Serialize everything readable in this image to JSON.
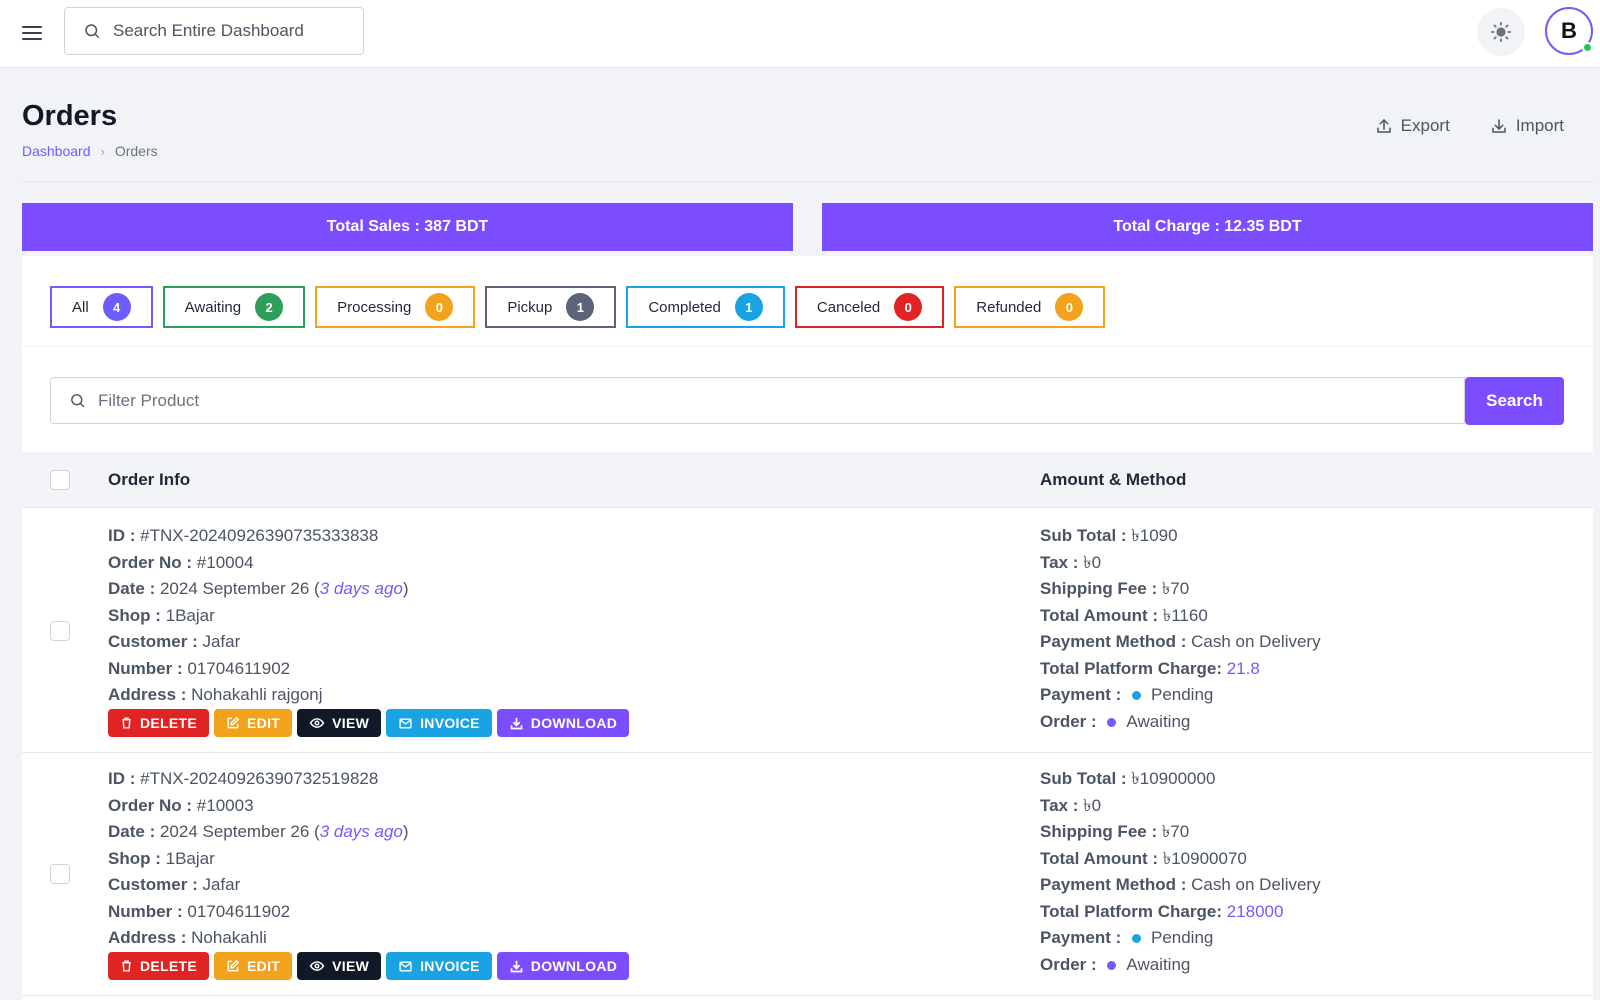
{
  "topbar": {
    "search_placeholder": "Search Entire Dashboard",
    "avatar_letter": "B"
  },
  "page": {
    "title": "Orders",
    "breadcrumb": [
      "Dashboard",
      "Orders"
    ],
    "export_label": "Export",
    "import_label": "Import"
  },
  "totals": {
    "sales": "Total Sales : 387 BDT",
    "charge": "Total Charge : 12.35 BDT"
  },
  "tabs": [
    {
      "label": "All",
      "count": "4",
      "color": "#6d5dfc"
    },
    {
      "label": "Awaiting",
      "count": "2",
      "color": "#2e9e5b"
    },
    {
      "label": "Processing",
      "count": "0",
      "color": "#f2a31b"
    },
    {
      "label": "Pickup",
      "count": "1",
      "color": "#5b6478"
    },
    {
      "label": "Completed",
      "count": "1",
      "color": "#1aa3e3"
    },
    {
      "label": "Canceled",
      "count": "0",
      "color": "#e02424"
    },
    {
      "label": "Refunded",
      "count": "0",
      "color": "#f2a31b"
    }
  ],
  "filter": {
    "placeholder": "Filter Product",
    "search_label": "Search"
  },
  "table": {
    "col_order_info": "Order Info",
    "col_amount_method": "Amount & Method"
  },
  "labels": {
    "id": "ID :",
    "order_no": "Order No :",
    "date": "Date :",
    "shop": "Shop :",
    "customer": "Customer :",
    "number": "Number :",
    "address": "Address :",
    "sub_total": "Sub Total :",
    "tax": "Tax :",
    "shipping_fee": "Shipping Fee :",
    "total_amount": "Total Amount :",
    "payment_method": "Payment Method :",
    "total_platform_charge": "Total Platform Charge:",
    "payment": "Payment :",
    "order": "Order :"
  },
  "actions": {
    "delete": "DELETE",
    "edit": "EDIT",
    "view": "VIEW",
    "invoice": "INVOICE",
    "download": "DOWNLOAD"
  },
  "colors": {
    "accent": "#7c4dff",
    "delete": "#e02424",
    "edit": "#f2a31b",
    "view": "#111827",
    "invoice": "#1aa3e3",
    "download": "#7c4dff",
    "payment_dot": "#1aa3e3",
    "order_dot": "#6d5dfc"
  },
  "orders": [
    {
      "id": "#TNX-20240926390735333838",
      "order_no": "#10004",
      "date": "2024 September 26",
      "ago": "3 days ago",
      "shop": "1Bajar",
      "customer": "Jafar",
      "number": "01704611902",
      "address": "Nohakahli rajgonj",
      "sub_total": "৳1090",
      "tax": "৳0",
      "shipping_fee": "৳70",
      "total_amount": "৳1160",
      "payment_method": "Cash on Delivery",
      "platform_charge": "21.8",
      "payment_status": "Pending",
      "order_status": "Awaiting"
    },
    {
      "id": "#TNX-20240926390732519828",
      "order_no": "#10003",
      "date": "2024 September 26",
      "ago": "3 days ago",
      "shop": "1Bajar",
      "customer": "Jafar",
      "number": "01704611902",
      "address": "Nohakahli",
      "sub_total": "৳10900000",
      "tax": "৳0",
      "shipping_fee": "৳70",
      "total_amount": "৳10900070",
      "payment_method": "Cash on Delivery",
      "platform_charge": "218000",
      "payment_status": "Pending",
      "order_status": "Awaiting"
    }
  ]
}
